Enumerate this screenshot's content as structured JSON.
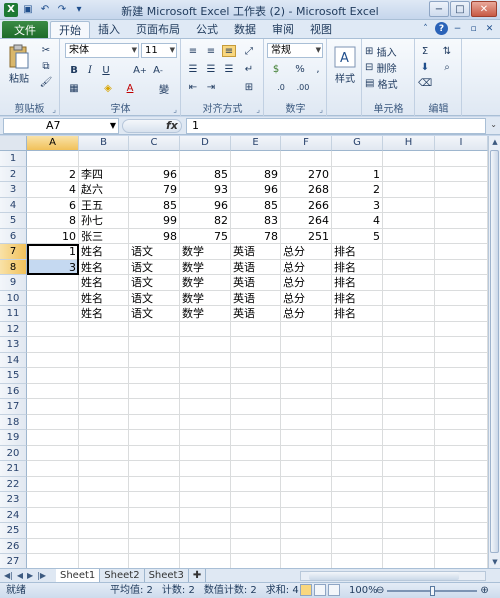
{
  "window": {
    "title": "新建 Microsoft Excel 工作表 (2) - Microsoft Excel"
  },
  "qat": {
    "logo": "X",
    "save_icon": "save-icon",
    "undo_icon": "undo-icon",
    "redo_icon": "redo-icon"
  },
  "tabs": {
    "file": "文件",
    "items": [
      "开始",
      "插入",
      "页面布局",
      "公式",
      "数据",
      "审阅",
      "视图"
    ]
  },
  "ribbon": {
    "clipboard": {
      "label": "剪贴板",
      "paste": "粘贴"
    },
    "font": {
      "label": "字体",
      "name": "宋体",
      "size": "11"
    },
    "alignment": {
      "label": "对齐方式"
    },
    "number": {
      "label": "数字",
      "format": "常规"
    },
    "styles": {
      "label": "样式",
      "button": "样式"
    },
    "cells": {
      "label": "单元格",
      "insert": "插入",
      "delete": "删除",
      "format": "格式"
    },
    "editing": {
      "label": "编辑"
    }
  },
  "formula_bar": {
    "name_box": "A7",
    "fx": "fx",
    "value": "1"
  },
  "grid": {
    "columns": [
      "A",
      "B",
      "C",
      "D",
      "E",
      "F",
      "G",
      "H",
      "I"
    ],
    "rows": [
      "1",
      "2",
      "3",
      "4",
      "5",
      "6",
      "7",
      "8",
      "9",
      "10",
      "11",
      "12",
      "13",
      "14",
      "15",
      "16",
      "17",
      "18",
      "19",
      "20",
      "21",
      "22",
      "23",
      "24",
      "25",
      "26",
      "27"
    ],
    "data_rows": [
      {
        "a": "2",
        "b": "李四",
        "c": "96",
        "d": "85",
        "e": "89",
        "f": "270",
        "g": "1"
      },
      {
        "a": "4",
        "b": "赵六",
        "c": "79",
        "d": "93",
        "e": "96",
        "f": "268",
        "g": "2"
      },
      {
        "a": "6",
        "b": "王五",
        "c": "85",
        "d": "96",
        "e": "85",
        "f": "266",
        "g": "3"
      },
      {
        "a": "8",
        "b": "孙七",
        "c": "99",
        "d": "82",
        "e": "83",
        "f": "264",
        "g": "4"
      },
      {
        "a": "10",
        "b": "张三",
        "c": "98",
        "d": "75",
        "e": "78",
        "f": "251",
        "g": "5"
      }
    ],
    "header_rows": [
      {
        "a": "1",
        "b": "姓名",
        "c": "语文",
        "d": "数学",
        "e": "英语",
        "f": "总分",
        "g": "排名"
      },
      {
        "a": "3",
        "b": "姓名",
        "c": "语文",
        "d": "数学",
        "e": "英语",
        "f": "总分",
        "g": "排名"
      },
      {
        "a": "",
        "b": "姓名",
        "c": "语文",
        "d": "数学",
        "e": "英语",
        "f": "总分",
        "g": "排名"
      },
      {
        "a": "",
        "b": "姓名",
        "c": "语文",
        "d": "数学",
        "e": "英语",
        "f": "总分",
        "g": "排名"
      },
      {
        "a": "",
        "b": "姓名",
        "c": "语文",
        "d": "数学",
        "e": "英语",
        "f": "总分",
        "g": "排名"
      }
    ]
  },
  "sheets": {
    "tabs": [
      "Sheet1",
      "Sheet2",
      "Sheet3"
    ],
    "active": 0
  },
  "status": {
    "ready": "就绪",
    "average": "平均值: 2",
    "count": "计数: 2",
    "numeric_count": "数值计数: 2",
    "sum": "求和: 4",
    "zoom": "100%"
  }
}
